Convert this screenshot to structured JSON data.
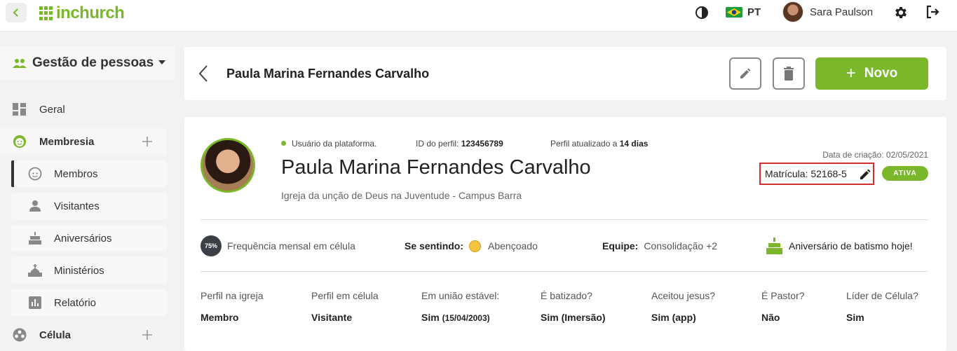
{
  "topbar": {
    "logo_text": "inchurch",
    "language": "PT",
    "user_name": "Sara Paulson"
  },
  "sidebar": {
    "module_title": "Gestão de pessoas",
    "items": [
      {
        "label": "Geral",
        "icon": "dashboard-icon"
      },
      {
        "label": "Membresia",
        "icon": "smile-icon"
      },
      {
        "label": "Membros",
        "icon": "face-icon"
      },
      {
        "label": "Visitantes",
        "icon": "person-icon"
      },
      {
        "label": "Aniversários",
        "icon": "cake-icon"
      },
      {
        "label": "Ministérios",
        "icon": "church-icon"
      },
      {
        "label": "Relatório",
        "icon": "bar-chart-icon"
      },
      {
        "label": "Célula",
        "icon": "group-icon"
      }
    ]
  },
  "header": {
    "title": "Paula Marina Fernandes Carvalho",
    "new_label": "Novo"
  },
  "profile": {
    "platform_user": "Usuário da plataforma.",
    "profile_id_label": "ID do perfil:",
    "profile_id": "123456789",
    "updated_label": "Perfil atualizado a",
    "updated_value": "14 dias",
    "name": "Paula Marina Fernandes Carvalho",
    "church": "Igreja da unção de Deus na Juventude - Campus Barra",
    "created": "Data de criação: 02/05/2021",
    "registration": "Matrícula: 52168-5",
    "status": "ATIVA"
  },
  "stats": {
    "frequency_pct": "75%",
    "frequency_label": "Frequência mensal em célula",
    "feeling_label": "Se sentindo:",
    "feeling_value": "Abençoado",
    "team_label": "Equipe:",
    "team_value": "Consolidação +2",
    "baptism": "Aniversário de batismo hoje!"
  },
  "fields": [
    {
      "label": "Perfil na igreja",
      "value": "Membro",
      "extra": ""
    },
    {
      "label": "Perfil em célula",
      "value": "Visitante",
      "extra": ""
    },
    {
      "label": "Em união estável:",
      "value": "Sim",
      "extra": "(15/04/2003)"
    },
    {
      "label": "É batizado?",
      "value": "Sim (Imersão)",
      "extra": ""
    },
    {
      "label": "Aceitou jesus?",
      "value": "Sim (app)",
      "extra": ""
    },
    {
      "label": "É Pastor?",
      "value": "Não",
      "extra": ""
    },
    {
      "label": "Líder de Célula?",
      "value": "Sim",
      "extra": ""
    }
  ],
  "colors": {
    "accent": "#7ab72b",
    "highlight_border": "#d32f2f"
  }
}
